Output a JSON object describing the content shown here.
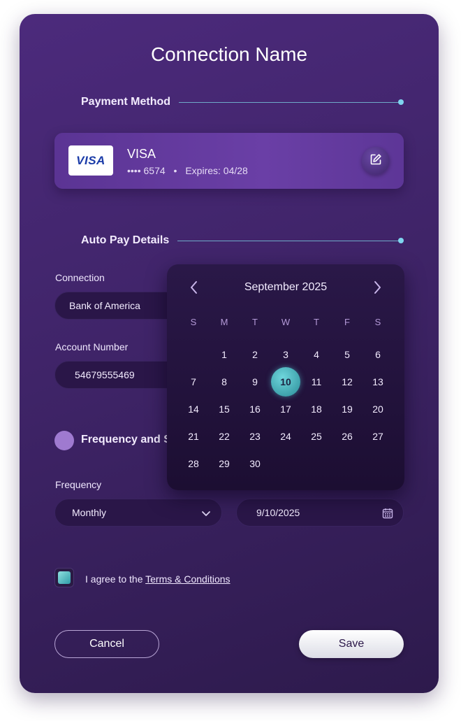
{
  "title": "Connection Name",
  "payment_section": {
    "label": "Payment Method"
  },
  "card": {
    "logo": "VISA",
    "brand": "VISA",
    "masked_number": "•••• 6574",
    "separator": "•",
    "expiry": "Expires: 04/28",
    "edit_icon": "edit-icon"
  },
  "autopay_section": {
    "label": "Auto Pay Details"
  },
  "connection": {
    "label": "Connection",
    "value": "Bank of America"
  },
  "account": {
    "label": "Account Number",
    "value": "54679555469"
  },
  "frequency_section": {
    "label": "Frequency and S"
  },
  "frequency": {
    "label": "Frequency",
    "value": "Monthly"
  },
  "start_date": {
    "value": "9/10/2025",
    "icon": "calendar-icon"
  },
  "terms": {
    "prefix": "I agree to the ",
    "link": "Terms & Conditions",
    "checked": true
  },
  "buttons": {
    "cancel": "Cancel",
    "save": "Save"
  },
  "datepicker": {
    "month_label": "September 2025",
    "weekdays": [
      "S",
      "M",
      "T",
      "W",
      "T",
      "F",
      "S"
    ],
    "weeks": [
      [
        "",
        "1",
        "2",
        "3",
        "4",
        "5",
        "6"
      ],
      [
        "7",
        "8",
        "9",
        "10",
        "11",
        "12",
        "13"
      ],
      [
        "14",
        "15",
        "16",
        "17",
        "18",
        "19",
        "20"
      ],
      [
        "21",
        "22",
        "23",
        "24",
        "25",
        "26",
        "27"
      ],
      [
        "28",
        "29",
        "30",
        "",
        "",
        "",
        ""
      ]
    ],
    "selected_day": "10"
  },
  "colors": {
    "accent": "#7fd5ef",
    "selected_day": "#3fb3bd",
    "modal_bg": "#3f2468",
    "card_bg": "#6a3fa6"
  }
}
